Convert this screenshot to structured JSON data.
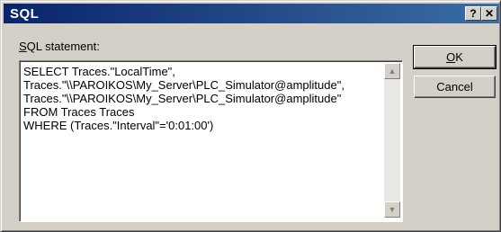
{
  "window": {
    "title": "SQL",
    "help_glyph": "?",
    "close_glyph": "✕"
  },
  "label": {
    "mnemonic": "S",
    "rest": "QL statement:"
  },
  "sql": {
    "text": "SELECT Traces.\"LocalTime\",\nTraces.\"\\\\PAROIKOS\\My_Server\\PLC_Simulator@amplitude\",\nTraces.\"\\\\PAROIKOS\\My_Server\\PLC_Simulator@amplitude\"\nFROM Traces Traces\nWHERE (Traces.\"Interval\"='0:01:00')"
  },
  "scrollbar": {
    "up_glyph": "▲",
    "down_glyph": "▼"
  },
  "buttons": {
    "ok_mnemonic": "O",
    "ok_rest": "K",
    "cancel": "Cancel"
  }
}
